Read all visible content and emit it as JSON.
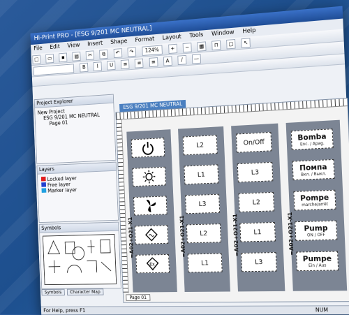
{
  "window": {
    "title": "Hi-Print PRO - [ESG 9/201 MC NEUTRAL]"
  },
  "menu": [
    "File",
    "Edit",
    "View",
    "Insert",
    "Shape",
    "Format",
    "Layout",
    "Tools",
    "Window",
    "Help"
  ],
  "toolbar": {
    "zoom": "124%"
  },
  "project_explorer": {
    "title": "Project Explorer",
    "items": [
      "New Project",
      "ESG 9/201 MC NEUTRAL",
      "Page 01"
    ]
  },
  "layers": {
    "title": "Layers",
    "items": [
      "Locked layer",
      "Free layer",
      "Marker layer"
    ]
  },
  "symbols": {
    "title": "Symbols"
  },
  "bottom_tabs": [
    "Symbols",
    "Character Map"
  ],
  "status": {
    "text": "For Help, press F1",
    "num": "NUM"
  },
  "document": {
    "tab": "ESG 9/201 MC NEUTRAL",
    "page_tab": "Page 01"
  },
  "columns": [
    {
      "tag": "=A02+O21-X1",
      "labels": [
        {
          "icon": "power-icon"
        },
        {
          "icon": "light-icon"
        },
        {
          "icon": "fan-icon"
        },
        {
          "icon": "heater-icon"
        },
        {
          "icon": "ex-icon"
        }
      ]
    },
    {
      "tag": "=A02+O21-X1",
      "labels": [
        {
          "text": "L2"
        },
        {
          "text": "L1"
        },
        {
          "text": "L3"
        },
        {
          "text": "L2"
        },
        {
          "text": "L1"
        }
      ]
    },
    {
      "tag": "=A02+O21-X1",
      "labels": [
        {
          "text": "On/Off"
        },
        {
          "text": "L3"
        },
        {
          "text": "L2"
        },
        {
          "text": "L1"
        },
        {
          "text": "L3"
        }
      ]
    },
    {
      "tag": "=A02+O21-X1",
      "labels": [
        {
          "big": "Bomba",
          "small": "Enc. / Apag."
        },
        {
          "big": "Помпа",
          "small": "Вкл. / Выкл."
        },
        {
          "big": "Pompe",
          "small": "marche/arrêt"
        },
        {
          "big": "Pump",
          "small": "ON / OFF"
        },
        {
          "big": "Pumpe",
          "small": "Ein / Aus"
        }
      ]
    }
  ]
}
